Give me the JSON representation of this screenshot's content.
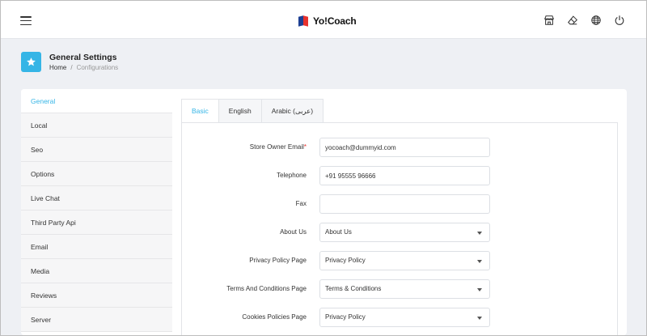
{
  "header": {
    "brand_name": "Yo!Coach",
    "icons": [
      "menu-icon",
      "store-icon",
      "eraser-icon",
      "globe-icon",
      "power-icon"
    ]
  },
  "page": {
    "title": "General Settings",
    "breadcrumb": {
      "home": "Home",
      "separator": "/",
      "current": "Configurations"
    },
    "accent_color": "#35b5e6"
  },
  "sidebar": {
    "items": [
      {
        "label": "General",
        "active": true
      },
      {
        "label": "Local"
      },
      {
        "label": "Seo"
      },
      {
        "label": "Options"
      },
      {
        "label": "Live Chat"
      },
      {
        "label": "Third Party Api"
      },
      {
        "label": "Email"
      },
      {
        "label": "Media"
      },
      {
        "label": "Reviews"
      },
      {
        "label": "Server"
      }
    ]
  },
  "tabs": [
    {
      "label": "Basic",
      "active": true
    },
    {
      "label": "English"
    },
    {
      "label": "Arabic (عربى)"
    }
  ],
  "form": {
    "store_owner_email": {
      "label": "Store Owner Email",
      "required_mark": "*",
      "value": "yocoach@dummyid.com"
    },
    "telephone": {
      "label": "Telephone",
      "value": "+91 95555 96666"
    },
    "fax": {
      "label": "Fax",
      "value": ""
    },
    "about_us": {
      "label": "About Us",
      "value": "About Us"
    },
    "privacy_policy": {
      "label": "Privacy Policy Page",
      "value": "Privacy Policy"
    },
    "terms": {
      "label": "Terms And Conditions Page",
      "value": "Terms & Conditions"
    },
    "cookies": {
      "label": "Cookies Policies Page",
      "value": "Privacy Policy"
    }
  }
}
